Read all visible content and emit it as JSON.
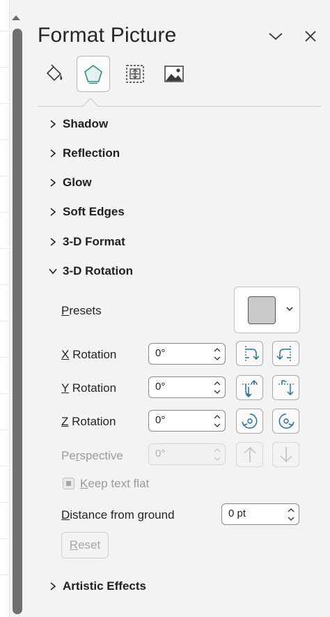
{
  "pane": {
    "title": "Format Picture",
    "options_icon": "chevron-down-icon",
    "close_icon": "close-icon"
  },
  "tabs": [
    {
      "name": "Fill & Line",
      "icon": "paint-bucket-icon",
      "active": false
    },
    {
      "name": "Effects",
      "icon": "pentagon-icon",
      "active": true
    },
    {
      "name": "Size & Properties",
      "icon": "size-properties-icon",
      "active": false
    },
    {
      "name": "Picture",
      "icon": "picture-icon",
      "active": false
    }
  ],
  "sections": {
    "shadow": "Shadow",
    "reflection": "Reflection",
    "glow": "Glow",
    "soft_edges": "Soft Edges",
    "format_3d": "3-D Format",
    "rotation_3d": "3-D Rotation",
    "artistic_effects": "Artistic Effects"
  },
  "rotation": {
    "presets": {
      "accel": "P",
      "rest": "resets"
    },
    "x": {
      "accel": "X",
      "rest": " Rotation",
      "value": "0°"
    },
    "y": {
      "accel": "Y",
      "rest": " Rotation",
      "value": "0°"
    },
    "z": {
      "accel": "Z",
      "rest": " Rotation",
      "value": "0°"
    },
    "perspective": {
      "pre": "Pe",
      "accel": "r",
      "rest": "spective",
      "value": "0°"
    },
    "keep_text_flat": {
      "accel": "K",
      "rest": "eep text flat",
      "checked": true,
      "disabled": true
    },
    "distance": {
      "accel": "D",
      "rest": "istance from ground",
      "value": "0 pt"
    },
    "reset": {
      "accel": "R",
      "rest": "eset"
    }
  },
  "colors": {
    "accent": "#1f6fb2",
    "pane_bg": "#f3f3f3"
  }
}
